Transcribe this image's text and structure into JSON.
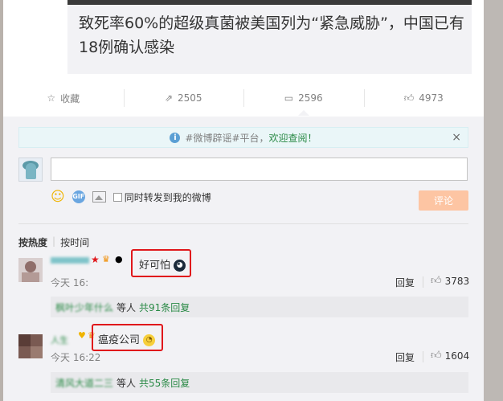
{
  "article": {
    "title": "致死率60%的超级真菌被美国列为“紧急威胁”，中国已有18例确认感染"
  },
  "actions": [
    {
      "icon": "star-icon",
      "label": "收藏"
    },
    {
      "icon": "share-icon",
      "label": "2505"
    },
    {
      "icon": "comment-icon",
      "label": "2596"
    },
    {
      "icon": "like-icon",
      "label": "4973"
    }
  ],
  "notice": {
    "prefix": "#微博辟谣#平台，",
    "link": "欢迎查阅！",
    "close": "×"
  },
  "composer": {
    "input_value": "",
    "forward_label": "同时转发到我的微博",
    "submit_label": "评论"
  },
  "sort": {
    "by_hot": "按热度",
    "separator": "|",
    "by_time": "按时间"
  },
  "comments": [
    {
      "user": "丶晓",
      "text": "好可怕",
      "time": "今天 16:",
      "reply_label": "回复",
      "likes": "3783",
      "sub_users": "枫叶少年什么",
      "sub_suffix": "等人",
      "sub_count": "共91条回复"
    },
    {
      "user": "人生",
      "text": "瘟疫公司",
      "time": "今天 16:22",
      "reply_label": "回复",
      "likes": "1604",
      "sub_users": "清风大道二三",
      "sub_suffix": "等人",
      "sub_count": "共55条回复"
    }
  ],
  "colors": {
    "link_green": "#2a8a46",
    "highlight_red": "#e0171b",
    "submit_disabled": "#fdc5a3",
    "panel_bg": "#f2f2f5"
  }
}
